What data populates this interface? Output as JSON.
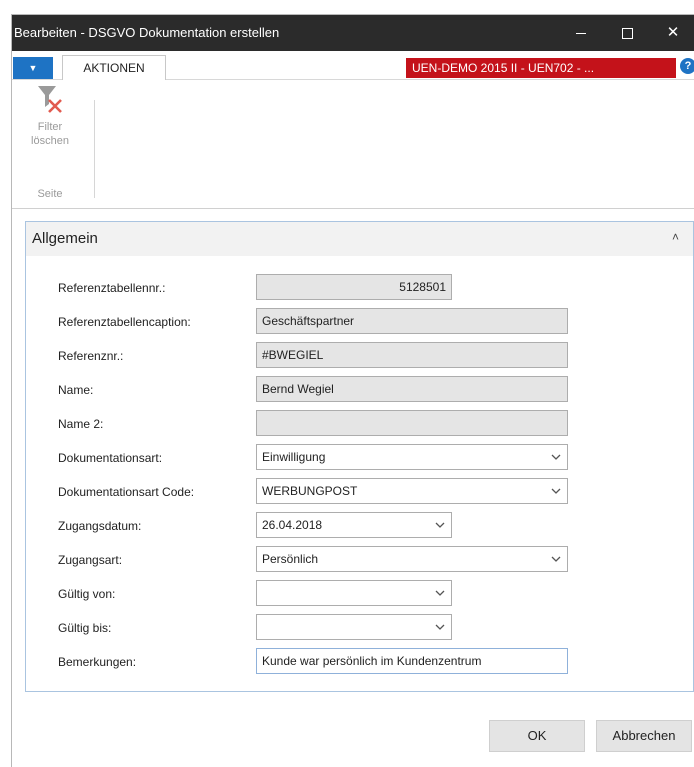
{
  "window": {
    "title": "Bearbeiten - DSGVO Dokumentation erstellen",
    "controls": {
      "close": "✕"
    }
  },
  "ribbon": {
    "menu_arrow": "▼",
    "tab_label": "AKTIONEN",
    "company": "UEN-DEMO 2015 II - UEN702 - ...",
    "help": "?",
    "filter_button": {
      "line1": "Filter",
      "line2": "löschen"
    },
    "group_label": "Seite"
  },
  "section": {
    "title": "Allgemein",
    "collapse": "˄"
  },
  "fields": [
    {
      "label": "Referenztabellennr.:",
      "value": "5128501"
    },
    {
      "label": "Referenztabellencaption:",
      "value": "Geschäftspartner"
    },
    {
      "label": "Referenznr.:",
      "value": "#BWEGIEL"
    },
    {
      "label": "Name:",
      "value": "Bernd Wegiel"
    },
    {
      "label": "Name 2:",
      "value": ""
    },
    {
      "label": "Dokumentationsart:",
      "value": "Einwilligung"
    },
    {
      "label": "Dokumentationsart Code:",
      "value": "WERBUNGPOST"
    },
    {
      "label": "Zugangsdatum:",
      "value": "26.04.2018"
    },
    {
      "label": "Zugangsart:",
      "value": "Persönlich"
    },
    {
      "label": "Gültig von:",
      "value": ""
    },
    {
      "label": "Gültig bis:",
      "value": ""
    },
    {
      "label": "Bemerkungen:",
      "value": "Kunde war persönlich im Kundenzentrum"
    }
  ],
  "buttons": {
    "ok": "OK",
    "cancel": "Abbrechen"
  },
  "colors": {
    "titlebar": "#2b2b2b",
    "accent": "#1e73c4",
    "company_badge": "#c4121a"
  }
}
